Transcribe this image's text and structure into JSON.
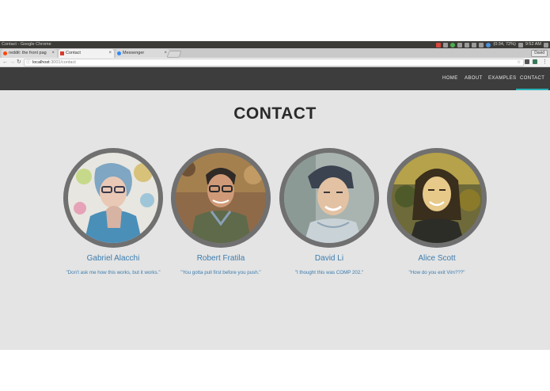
{
  "window": {
    "title": "Contact - Google Chrome"
  },
  "system_tray": {
    "status": "(0:34, 72%)",
    "clock": "9:52 AM"
  },
  "tabs": [
    {
      "label": "reddit: the front pag",
      "favicon": "reddit-icon"
    },
    {
      "label": "Contact",
      "favicon": "site-icon"
    },
    {
      "label": "Messenger",
      "favicon": "messenger-icon"
    }
  ],
  "user_button": "David",
  "address_bar": {
    "host": "localhost",
    "path": ":3001/contact"
  },
  "nav": {
    "home": "HOME",
    "about": "ABOUT",
    "examples": "EXAMPLES",
    "contact": "CONTACT"
  },
  "page": {
    "heading": "CONTACT"
  },
  "people": [
    {
      "name": "Gabriel Alacchi",
      "quote": "\"Don't ask me how this works, but it works.\""
    },
    {
      "name": "Robert Fratila",
      "quote": "\"You gotta pull first before you push.\""
    },
    {
      "name": "David Li",
      "quote": "\"I thought this was COMP 202.\""
    },
    {
      "name": "Alice Scott",
      "quote": "\"How do you exit Vim???\""
    }
  ],
  "colors": {
    "accent": "#28b1b8",
    "link": "#3b7cae",
    "nav_bg": "#3d3d3d",
    "page_bg": "#e4e4e4",
    "avatar_ring": "#707070"
  }
}
